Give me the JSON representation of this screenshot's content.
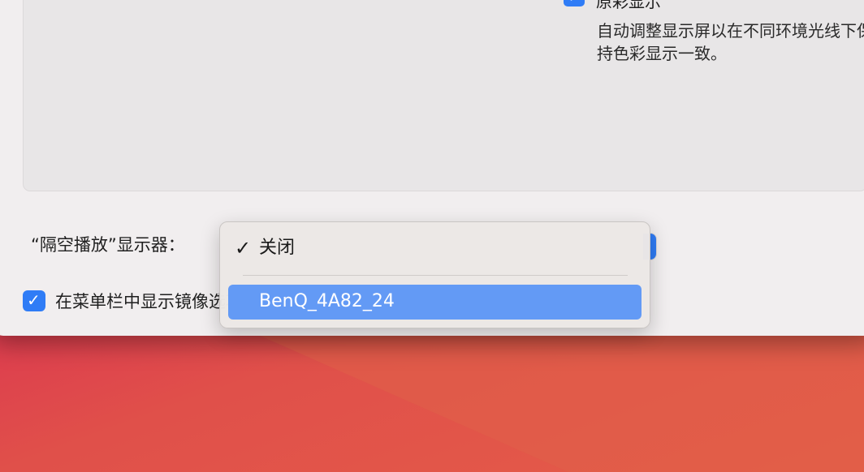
{
  "display_settings": {
    "true_tone": {
      "checked": true,
      "title": "原彩显示",
      "description": "自动调整显示屏以在不同环境光线下保持色彩显示一致。"
    },
    "airplay_display": {
      "label": "“隔空播放”显示器：",
      "menu": {
        "items": [
          {
            "label": "关闭",
            "checked": true,
            "highlighted": false
          },
          {
            "label": "BenQ_4A82_24",
            "checked": false,
            "highlighted": true
          }
        ]
      }
    },
    "show_mirroring_in_menubar": {
      "checked": true,
      "label": "在菜单栏中显示镜像选项"
    }
  },
  "colors": {
    "accent": "#2f7cf6",
    "menu_highlight": "#639af5",
    "window_bg": "#f1eeef"
  }
}
